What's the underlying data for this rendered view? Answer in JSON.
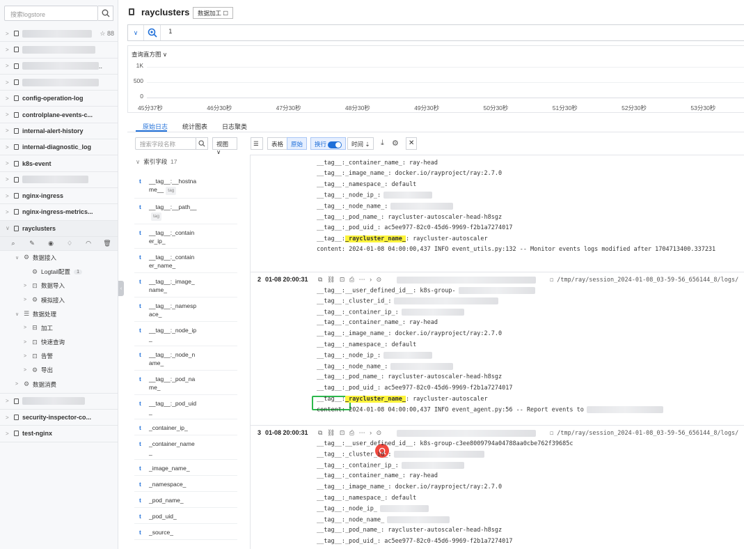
{
  "sidebar": {
    "search_placeholder": "搜索logstore",
    "top_tools": "☆ 88",
    "logstores": [
      {
        "name": "",
        "blurred": true,
        "blur_w": 100,
        "tools": true
      },
      {
        "name": "",
        "blurred": true,
        "blur_w": 105
      },
      {
        "name": "",
        "blurred": true,
        "blur_w": 110,
        "suffix": ".."
      },
      {
        "name": "",
        "blurred": true,
        "blur_w": 110
      },
      {
        "name": "config-operation-log"
      },
      {
        "name": "controlplane-events-c..."
      },
      {
        "name": "internal-alert-history"
      },
      {
        "name": "internal-diagnostic_log"
      },
      {
        "name": "k8s-event"
      },
      {
        "name": "",
        "blurred": true,
        "blur_w": 95
      },
      {
        "name": "nginx-ingress"
      },
      {
        "name": "nginx-ingress-metrics..."
      },
      {
        "name": "rayclusters",
        "expanded": true
      }
    ],
    "action_icons": [
      "search-icon",
      "edit-icon",
      "eye-icon",
      "alert-icon",
      "dashboard-icon",
      "delete-icon"
    ],
    "tree": [
      {
        "label": "数据接入",
        "level": 1,
        "caret": "∨",
        "icon": "⚙"
      },
      {
        "label": "Logtail配置",
        "level": 2,
        "caret": "",
        "icon": "⚙",
        "count": "1"
      },
      {
        "label": "数据导入",
        "level": 2,
        "caret": ">",
        "icon": "⊡"
      },
      {
        "label": "模拟接入",
        "level": 2,
        "caret": ">",
        "icon": "⚙"
      },
      {
        "label": "数据处理",
        "level": 1,
        "caret": "∨",
        "icon": "☰"
      },
      {
        "label": "加工",
        "level": 2,
        "caret": ">",
        "icon": "⊟"
      },
      {
        "label": "快速查询",
        "level": 2,
        "caret": ">",
        "icon": "⊡"
      },
      {
        "label": "告警",
        "level": 2,
        "caret": ">",
        "icon": "⊡"
      },
      {
        "label": "导出",
        "level": 2,
        "caret": ">",
        "icon": "⚙"
      },
      {
        "label": "数据消费",
        "level": 1,
        "caret": ">",
        "icon": "⚙"
      }
    ],
    "logstores_after": [
      {
        "name": "",
        "blurred": true,
        "blur_w": 90
      },
      {
        "name": "security-inspector-co..."
      },
      {
        "name": "test-nginx"
      }
    ]
  },
  "header": {
    "title": "rayclusters",
    "data_process_button": "数据加工 ☐"
  },
  "query": {
    "text": "1"
  },
  "histogram": {
    "title": "查询直方图 ∨"
  },
  "chart_data": {
    "type": "bar",
    "title": "查询直方图",
    "y_ticks": [
      "1K",
      "500",
      "0"
    ],
    "x_ticks": [
      "45分37秒",
      "46分30秒",
      "47分30秒",
      "48分30秒",
      "49分30秒",
      "50分30秒",
      "51分30秒",
      "52分30秒",
      "53分30秒"
    ]
  },
  "tabs": [
    {
      "label": "原始日志",
      "active": true
    },
    {
      "label": "统计图表",
      "active": false
    },
    {
      "label": "日志聚类",
      "active": false
    }
  ],
  "fields_panel": {
    "search_placeholder": "搜索字段名称",
    "view_label": "视图 ∨",
    "section_title": "索引字段",
    "section_count": "17",
    "fields": [
      {
        "l1": "__tag__:__hostna",
        "l2": "me__",
        "tag": "tag"
      },
      {
        "l1": "__tag__:__path__",
        "l2": "",
        "tag": "tag"
      },
      {
        "l1": "__tag__:_contain",
        "l2": "er_ip_"
      },
      {
        "l1": "__tag__:_contain",
        "l2": "er_name_"
      },
      {
        "l1": "__tag__:_image_",
        "l2": "name_"
      },
      {
        "l1": "__tag__:_namesp",
        "l2": "ace_"
      },
      {
        "l1": "__tag__:_node_ip",
        "l2": "_"
      },
      {
        "l1": "__tag__:_node_n",
        "l2": "ame_"
      },
      {
        "l1": "__tag__:_pod_na",
        "l2": "me_"
      },
      {
        "l1": "__tag__:_pod_uid",
        "l2": "_"
      },
      {
        "l1": "_container_ip_",
        "l2": ""
      },
      {
        "l1": "_container_name",
        "l2": "_"
      },
      {
        "l1": "_image_name_",
        "l2": ""
      },
      {
        "l1": "_namespace_",
        "l2": ""
      },
      {
        "l1": "_pod_name_",
        "l2": ""
      },
      {
        "l1": "_pod_uid_",
        "l2": ""
      },
      {
        "l1": "_source_",
        "l2": ""
      }
    ]
  },
  "log_toolbar": {
    "table": "表格",
    "raw": "原始",
    "wrap": "换行",
    "time": "时间 ⇣"
  },
  "logs": [
    {
      "top": -10,
      "header": null,
      "lines": [
        {
          "k": "__tag__:_container_ip_:",
          "v": "",
          "blur": 90
        },
        {
          "k": "__tag__:_container_name_:",
          "v": " ray-head"
        },
        {
          "k": "__tag__:_image_name_:",
          "v": " docker.io/rayproject/ray:2.7.0"
        },
        {
          "k": "__tag__:_namespace_:",
          "v": " default"
        },
        {
          "k": "__tag__:_node_ip_:",
          "v": "",
          "blur": 70
        },
        {
          "k": "__tag__:_node_name_:",
          "v": "",
          "blur": 90
        },
        {
          "k": "__tag__:_pod_name_:",
          "v": " raycluster-autoscaler-head-h8sgz"
        },
        {
          "k": "__tag__:_pod_uid_:",
          "v": " ac5ee977-82c0-45d6-9969-f2b1a7274017"
        },
        {
          "k": "__tag__:",
          "hl": "_raycluster_name_",
          "v": ": raycluster-autoscaler"
        },
        {
          "k": "content:",
          "v": " 2024-01-08 04:00:00,437        INFO event_utils.py:132 -- Monitor events logs modified after 1704713400.337231"
        }
      ]
    },
    {
      "top": 173,
      "header": {
        "num": "2",
        "time": "01-08 20:00:31",
        "src": "/tmp/ray/session_2024-01-08_03-59-56_656144_8/logs/"
      },
      "lines": [
        {
          "k": "__tag__:__user_defined_id__:",
          "v": " k8s-group-",
          "blur": 110
        },
        {
          "k": "__tag__:_cluster_id_:",
          "v": "",
          "blur": 150
        },
        {
          "k": "__tag__:_container_ip_:",
          "v": "",
          "blur": 90
        },
        {
          "k": "__tag__:_container_name_:",
          "v": " ray-head"
        },
        {
          "k": "__tag__:_image_name_:",
          "v": " docker.io/rayproject/ray:2.7.0"
        },
        {
          "k": "__tag__:_namespace_:",
          "v": " default"
        },
        {
          "k": "__tag__:_node_ip_:",
          "v": "",
          "blur": 70
        },
        {
          "k": "__tag__:_node_name_:",
          "v": "",
          "blur": 90
        },
        {
          "k": "__tag__:_pod_name_:",
          "v": " raycluster-autoscaler-head-h8sgz"
        },
        {
          "k": "__tag__:_pod_uid_:",
          "v": " ac5ee977-82c0-45d6-9969-f2b1a7274017"
        },
        {
          "k": "__tag__:",
          "hl": "_raycluster_name_",
          "v": ": raycluster-autoscaler"
        },
        {
          "k": "content:",
          "v": " 2024-01-08 04:00:00,437        INFO event_agent.py:56 -- Report events to",
          "blur": 110
        }
      ]
    },
    {
      "top": 393,
      "header": {
        "num": "3",
        "time": "01-08 20:00:31",
        "src": "/tmp/ray/session_2024-01-08_03-59-56_656144_8/logs/"
      },
      "lines": [
        {
          "k": "__tag__:__user_defined_id__:",
          "v": " k8s-group-c3ee8009794a04788aa0cbe762f39685c"
        },
        {
          "k": "__tag__:_cluster_id_:",
          "v": "",
          "blur": 130
        },
        {
          "k": "__tag__:_container_ip_:",
          "v": "",
          "blur": 90
        },
        {
          "k": "__tag__:_container_name_:",
          "v": " ray-head"
        },
        {
          "k": "__tag__:_image_name_:",
          "v": " docker.io/rayproject/ray:2.7.0"
        },
        {
          "k": "__tag__:_namespace_:",
          "v": " default"
        },
        {
          "k": "__tag__:_node_ip_",
          "v": "",
          "blur": 70
        },
        {
          "k": "__tag__:_node_name_",
          "v": "",
          "blur": 90
        },
        {
          "k": "__tag__:_pod_name_:",
          "v": " raycluster-autoscaler-head-h8sgz"
        },
        {
          "k": "__tag__:_pod_uid_:",
          "v": " ac5ee977-82c0-45d6-9969-f2b1a7274017"
        }
      ]
    }
  ]
}
